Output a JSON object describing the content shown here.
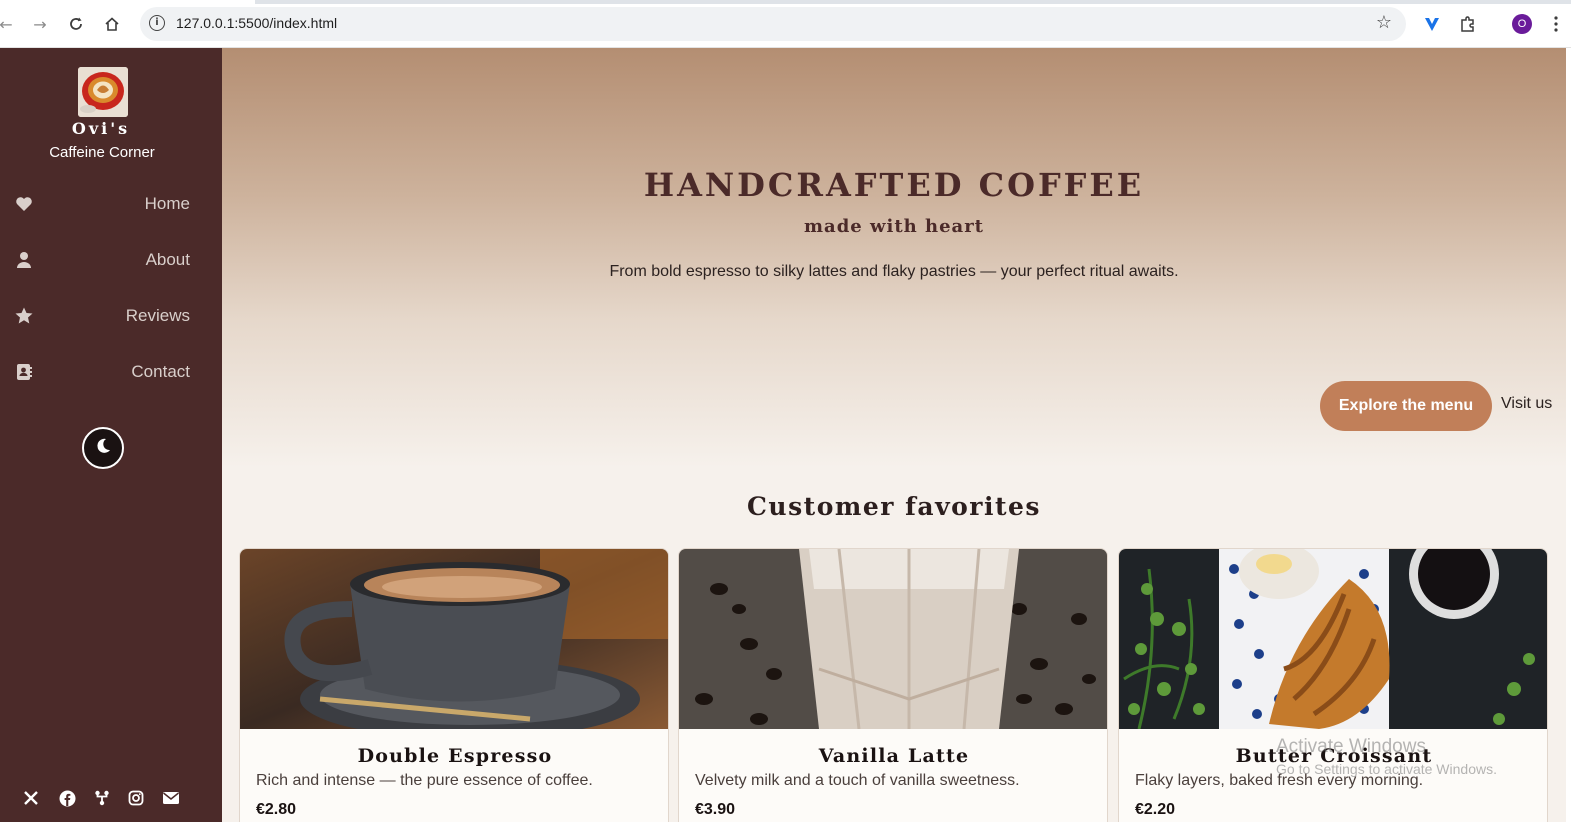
{
  "browser": {
    "url": "127.0.0.1:5500/index.html",
    "profile_initial": "O",
    "icons": [
      "back-icon",
      "forward-icon",
      "reload-icon",
      "home-icon",
      "site-info-icon",
      "bookmark-star-icon",
      "extension-icon",
      "extensions-puzzle-icon",
      "profile-avatar",
      "menu-dots-icon"
    ]
  },
  "sidebar": {
    "brand_name": "Ovi's",
    "brand_sub": "Caffeine Corner",
    "items": [
      {
        "label": "Home",
        "icon": "heart-icon"
      },
      {
        "label": "About",
        "icon": "user-icon"
      },
      {
        "label": "Reviews",
        "icon": "star-icon"
      },
      {
        "label": "Contact",
        "icon": "contact-book-icon"
      }
    ],
    "theme_toggle_icon": "moon-icon",
    "social": [
      "x-icon",
      "facebook-icon",
      "fork-icon",
      "instagram-icon",
      "mail-icon"
    ]
  },
  "hero": {
    "title": "HANDCRAFTED COFFEE",
    "subtitle": "made with heart",
    "description": "From bold espresso to silky lattes and flaky pastries — your perfect ritual awaits.",
    "primary_button": "Explore the menu",
    "secondary_link": "Visit us"
  },
  "favorites": {
    "title": "Customer favorites",
    "items": [
      {
        "name": "Double Espresso",
        "desc": "Rich and intense — the pure essence of coffee.",
        "price": "€2.80"
      },
      {
        "name": "Vanilla Latte",
        "desc": "Velvety milk and a touch of vanilla sweetness.",
        "price": "€3.90"
      },
      {
        "name": "Butter Croissant",
        "desc": "Flaky layers, baked fresh every morning.",
        "price": "€2.20"
      }
    ]
  },
  "overlay": {
    "line1": "Activate Windows",
    "line2": "Go to Settings to activate Windows."
  },
  "colors": {
    "sidebar": "#4b2a29",
    "accent": "#c17f59",
    "heading": "#4b2a29",
    "background": "#f6f1ec"
  }
}
